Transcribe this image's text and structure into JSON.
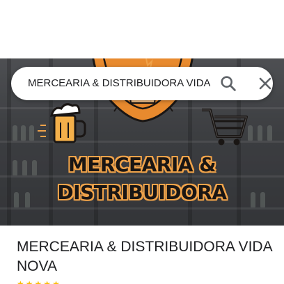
{
  "search": {
    "query": "MERCEARIA & DISTRIBUIDORA VIDA NOVA",
    "search_icon": "search-icon",
    "close_icon": "close-icon"
  },
  "hero": {
    "logo_line1": "MERCEARIA &",
    "logo_line2": "DISTRIBUIDORA",
    "icons": [
      "beer-mug-icon",
      "shopping-cart-icon",
      "bottle-cap-logo"
    ]
  },
  "place": {
    "name": "MERCEARIA & DISTRIBUIDORA VIDA NOVA"
  },
  "colors": {
    "accent_orange": "#f0a34a",
    "logo_dark": "#1a1614",
    "star": "#fbbc04",
    "text": "#202124"
  }
}
